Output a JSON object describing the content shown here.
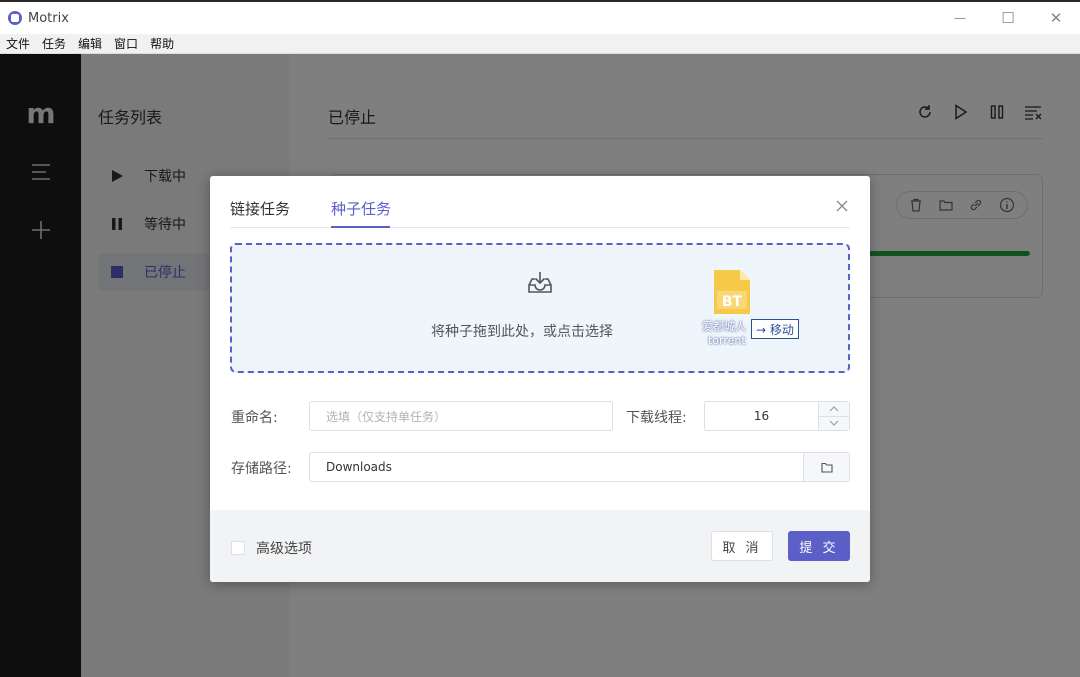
{
  "window": {
    "title": "Motrix",
    "controls": {
      "minimize": "—",
      "maximize": "☐",
      "close": "✕"
    }
  },
  "menu": [
    "文件",
    "任务",
    "编辑",
    "窗口",
    "帮助"
  ],
  "sidebar": {
    "logo": "m",
    "icons": [
      "menu-icon",
      "add-icon"
    ]
  },
  "subnav": {
    "title": "任务列表",
    "items": [
      {
        "label": "下载中",
        "icon": "play-icon"
      },
      {
        "label": "等待中",
        "icon": "pause-icon"
      },
      {
        "label": "已停止",
        "icon": "stop-icon",
        "active": true
      }
    ]
  },
  "main": {
    "title": "已停止",
    "toolbar": [
      "refresh-icon",
      "play-icon",
      "pause-icon",
      "clear-icon"
    ],
    "task": {
      "actions": [
        "trash-icon",
        "folder-icon",
        "link-icon",
        "info-icon"
      ],
      "progress": 1.0
    }
  },
  "dialog": {
    "tabs": [
      {
        "label": "链接任务",
        "active": false
      },
      {
        "label": "种子任务",
        "active": true
      }
    ],
    "dropzone": {
      "text": "将种子拖到此处，或点击选择",
      "drag_file_name": "爱都城人",
      "drag_file_ext": "torrent",
      "file_badge": "BT",
      "drag_tip": "→ 移动"
    },
    "rename": {
      "label": "重命名:",
      "placeholder": "选填（仅支持单任务）",
      "value": ""
    },
    "threads": {
      "label": "下载线程:",
      "value": "16"
    },
    "path": {
      "label": "存储路径:",
      "value": "Downloads"
    },
    "advanced": {
      "label": "高级选项",
      "checked": false
    },
    "buttons": {
      "cancel": "取 消",
      "submit": "提 交"
    }
  },
  "colors": {
    "accent": "#5b5fc7",
    "progress": "#23a640",
    "sidebar": "#1c1c1c"
  }
}
